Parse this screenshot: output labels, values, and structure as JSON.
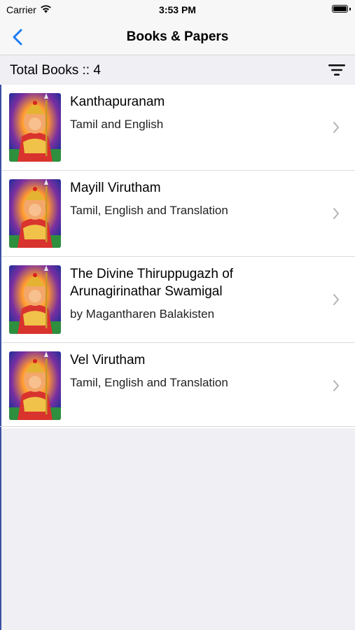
{
  "status_bar": {
    "carrier": "Carrier",
    "time": "3:53 PM"
  },
  "nav": {
    "title": "Books & Papers"
  },
  "header": {
    "total_books": "Total Books :: 4"
  },
  "icons": {
    "back": "chevron-left-icon",
    "filter": "filter-lines-icon",
    "row": "chevron-right-icon"
  },
  "colors": {
    "accent": "#1a7cf6",
    "background": "#efeff4",
    "row_bg": "#ffffff"
  },
  "books": [
    {
      "title": "Kanthapuranam",
      "subtitle": "Tamil and English"
    },
    {
      "title": "Mayill Virutham",
      "subtitle": "Tamil, English and Translation"
    },
    {
      "title": "The Divine Thiruppugazh of Arunagirinathar Swamigal",
      "subtitle": "by Magantharen Balakisten"
    },
    {
      "title": "Vel Virutham",
      "subtitle": "Tamil, English and Translation"
    }
  ]
}
